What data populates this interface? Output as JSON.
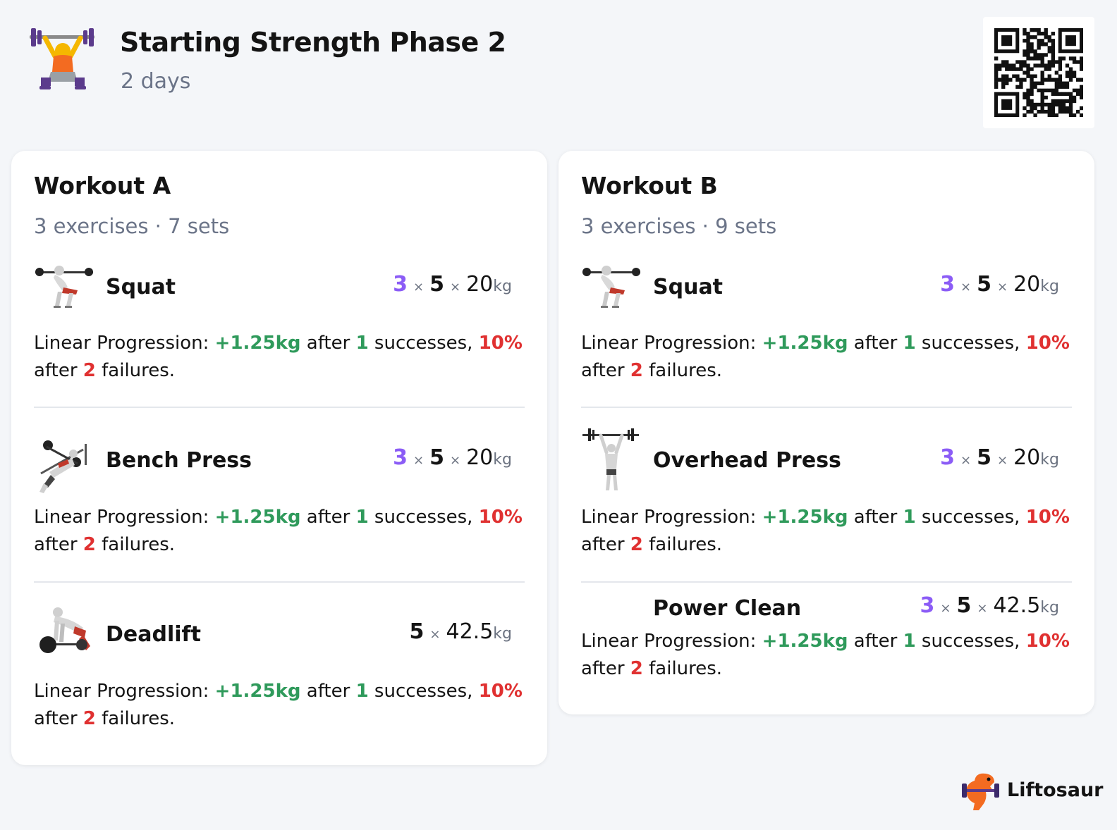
{
  "program": {
    "title": "Starting Strength Phase 2",
    "subtitle": "2 days",
    "icon": "weightlifter-icon"
  },
  "qr_code": "qr-code",
  "workouts": [
    {
      "title": "Workout A",
      "summary_exercises": "3 exercises",
      "summary_sep": " · ",
      "summary_sets": "7 sets",
      "exercises": [
        {
          "name": "Squat",
          "icon": "squat-icon",
          "sets": "3",
          "reps": "5",
          "weight": "20",
          "unit": "kg",
          "desc": {
            "prefix": "Linear Progression: ",
            "inc": "+1.25kg",
            "after1": " after ",
            "succ": "1",
            "mid": " successes, ",
            "dec": "10%",
            "after2": "after ",
            "fail": "2",
            "end": " failures."
          }
        },
        {
          "name": "Bench Press",
          "icon": "bench-press-icon",
          "sets": "3",
          "reps": "5",
          "weight": "20",
          "unit": "kg",
          "desc": {
            "prefix": "Linear Progression: ",
            "inc": "+1.25kg",
            "after1": " after ",
            "succ": "1",
            "mid": " successes, ",
            "dec": "10%",
            "after2": "after ",
            "fail": "2",
            "end": " failures."
          }
        },
        {
          "name": "Deadlift",
          "icon": "deadlift-icon",
          "sets": "",
          "reps": "5",
          "weight": "42.5",
          "unit": "kg",
          "desc": {
            "prefix": "Linear Progression: ",
            "inc": "+1.25kg",
            "after1": " after ",
            "succ": "1",
            "mid": " successes, ",
            "dec": "10%",
            "after2": "after ",
            "fail": "2",
            "end": " failures."
          }
        }
      ]
    },
    {
      "title": "Workout B",
      "summary_exercises": "3 exercises",
      "summary_sep": " · ",
      "summary_sets": "9 sets",
      "exercises": [
        {
          "name": "Squat",
          "icon": "squat-icon",
          "sets": "3",
          "reps": "5",
          "weight": "20",
          "unit": "kg",
          "desc": {
            "prefix": "Linear Progression: ",
            "inc": "+1.25kg",
            "after1": " after ",
            "succ": "1",
            "mid": " successes, ",
            "dec": "10%",
            "after2": "after ",
            "fail": "2",
            "end": " failures."
          }
        },
        {
          "name": "Overhead Press",
          "icon": "overhead-press-icon",
          "sets": "3",
          "reps": "5",
          "weight": "20",
          "unit": "kg",
          "desc": {
            "prefix": "Linear Progression: ",
            "inc": "+1.25kg",
            "after1": " after ",
            "succ": "1",
            "mid": " successes, ",
            "dec": "10%",
            "after2": "after ",
            "fail": "2",
            "end": " failures."
          }
        },
        {
          "name": "Power Clean",
          "icon": "",
          "sets": "3",
          "reps": "5",
          "weight": "42.5",
          "unit": "kg",
          "desc": {
            "prefix": "Linear Progression: ",
            "inc": "+1.25kg",
            "after1": " after ",
            "succ": "1",
            "mid": " successes, ",
            "dec": "10%",
            "after2": "after ",
            "fail": "2",
            "end": " failures."
          }
        }
      ]
    }
  ],
  "brand": {
    "name": "Liftosaur",
    "icon": "dinosaur-logo-icon"
  },
  "colors": {
    "sets": "#8b5cf6",
    "increase": "#2f9a5b",
    "decrease": "#e03131",
    "muted": "#6b7488"
  }
}
